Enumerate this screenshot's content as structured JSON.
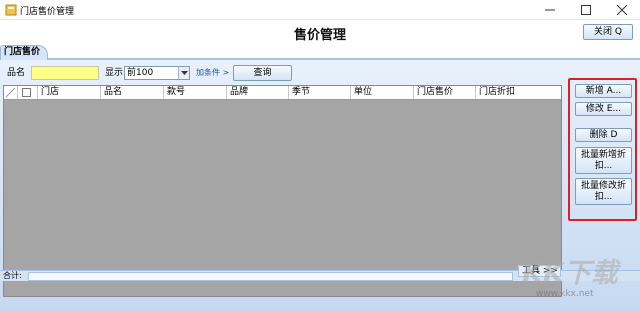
{
  "window": {
    "title": "门店售价管理",
    "min_icon": "minimize-icon",
    "max_icon": "maximize-icon",
    "close_icon": "close-icon"
  },
  "header": {
    "page_title": "售价管理",
    "close_button": "关闭 Q"
  },
  "tab": {
    "label": "门店售价"
  },
  "search": {
    "name_label": "品名",
    "name_value": "",
    "show_label": "显示",
    "show_select_value": "前100",
    "add_condition_link": "加条件 >",
    "query_button": "查询"
  },
  "grid": {
    "columns": [
      "门店",
      "品名",
      "款号",
      "品牌",
      "季节",
      "单位",
      "门店售价",
      "门店折扣"
    ]
  },
  "footer": {
    "sum_label": "合计:",
    "sum_value": "",
    "tools_button": "工具 >>"
  },
  "actions": {
    "add": "新增 A...",
    "edit": "修改 E...",
    "delete": "删除 D",
    "batch_add_discount": "批量新增折扣...",
    "batch_edit_discount": "批量修改折扣..."
  },
  "watermark": {
    "text": "KK下载",
    "url": "www.kkx.net"
  },
  "colors": {
    "highlight_border": "#e02020",
    "name_input_bg": "#ffff88",
    "grid_bg": "#a5a5a5",
    "content_bg": "#dbe7f6"
  }
}
